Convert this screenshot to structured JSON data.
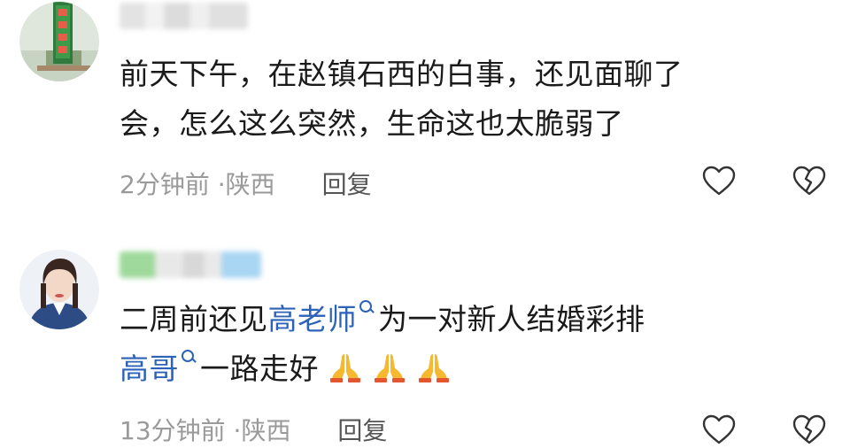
{
  "comments": [
    {
      "text_line1": "前天下午，在赵镇石西的白事，还见面聊了",
      "text_line2": "会，怎么这么突然，生命这也太脆弱了",
      "time": "2分钟前",
      "dot": "·",
      "location": "陕西",
      "reply_label": "回复",
      "avatar_sign_text": "现代农业园"
    },
    {
      "line1_a": "二周前还见",
      "line1_link": "高老师",
      "line1_b": "为一对新人结婚彩排",
      "line2_link": "高哥",
      "line2_b": "一路走好",
      "emoji_names": [
        "folded-hands",
        "folded-hands",
        "folded-hands"
      ],
      "time": "13分钟前",
      "dot": "·",
      "location": "陕西",
      "reply_label": "回复"
    }
  ],
  "colors": {
    "link": "#2c62b8",
    "meta": "#9a9a9a"
  }
}
